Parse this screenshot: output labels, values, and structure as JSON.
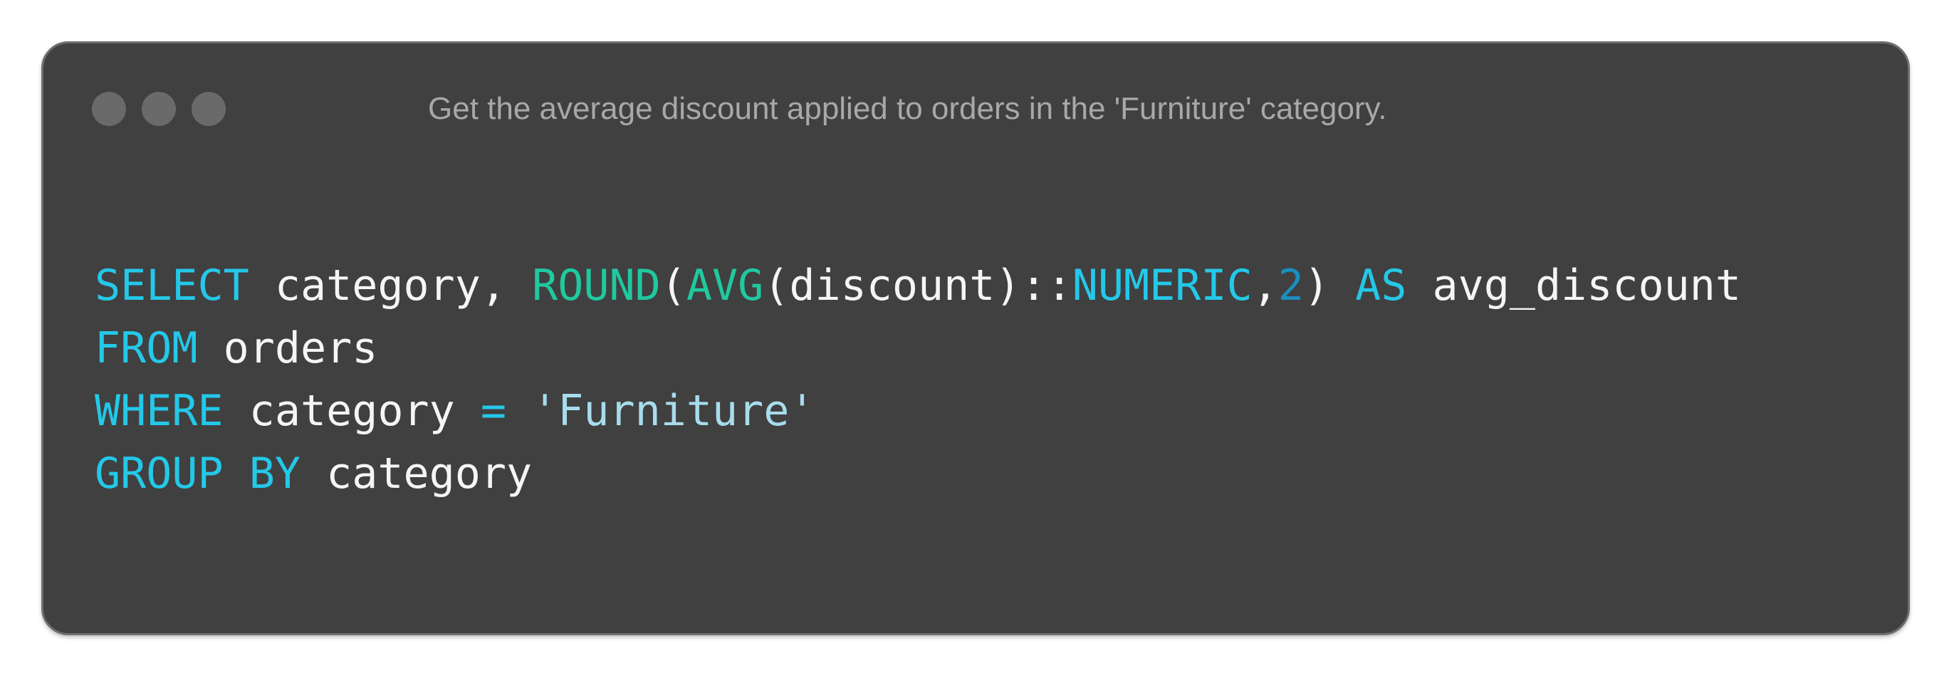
{
  "window": {
    "title": "Get the average discount applied to orders in the 'Furniture' category.",
    "controls": [
      "dot-icon",
      "dot-icon",
      "dot-icon"
    ]
  },
  "code": {
    "language": "SQL",
    "lines": [
      {
        "tokens": [
          {
            "type": "kw",
            "text": "SELECT"
          },
          {
            "type": "pl",
            "text": " category, "
          },
          {
            "type": "fn",
            "text": "ROUND"
          },
          {
            "type": "pl",
            "text": "("
          },
          {
            "type": "fn",
            "text": "AVG"
          },
          {
            "type": "pl",
            "text": "(discount)::"
          },
          {
            "type": "kw",
            "text": "NUMERIC"
          },
          {
            "type": "pl",
            "text": ","
          },
          {
            "type": "num",
            "text": "2"
          },
          {
            "type": "pl",
            "text": ") "
          },
          {
            "type": "kw",
            "text": "AS"
          },
          {
            "type": "pl",
            "text": " avg_discount"
          }
        ]
      },
      {
        "tokens": [
          {
            "type": "kw",
            "text": "FROM"
          },
          {
            "type": "pl",
            "text": " orders"
          }
        ]
      },
      {
        "tokens": [
          {
            "type": "kw",
            "text": "WHERE"
          },
          {
            "type": "pl",
            "text": " category "
          },
          {
            "type": "op",
            "text": "="
          },
          {
            "type": "pl",
            "text": " "
          },
          {
            "type": "str",
            "text": "'Furniture'"
          }
        ]
      },
      {
        "tokens": [
          {
            "type": "kw",
            "text": "GROUP BY"
          },
          {
            "type": "pl",
            "text": " category"
          }
        ]
      }
    ]
  },
  "colors": {
    "background": "#404040",
    "keyword": "#24c8e8",
    "function": "#20c9a0",
    "number": "#1a8fc0",
    "string": "#a8dcec",
    "plain": "#f5f5f5",
    "title": "#a8a8a8"
  }
}
